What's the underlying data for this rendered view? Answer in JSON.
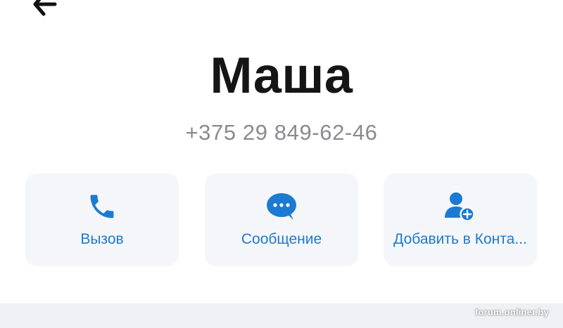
{
  "contact": {
    "name": "Маша",
    "phone": "+375 29 849-62-46"
  },
  "actions": [
    {
      "label": "Вызов",
      "icon": "phone-icon"
    },
    {
      "label": "Сообщение",
      "icon": "message-bubble-icon"
    },
    {
      "label": "Добавить в Конта...",
      "icon": "add-person-icon"
    }
  ],
  "watermark": "forum.onliner.by",
  "colors": {
    "accent": "#1b7bd2",
    "name_text": "#151515",
    "phone_text": "#8a8a8f",
    "card_bg": "#f5f6f9",
    "bottom_bar": "#eff0f4"
  }
}
